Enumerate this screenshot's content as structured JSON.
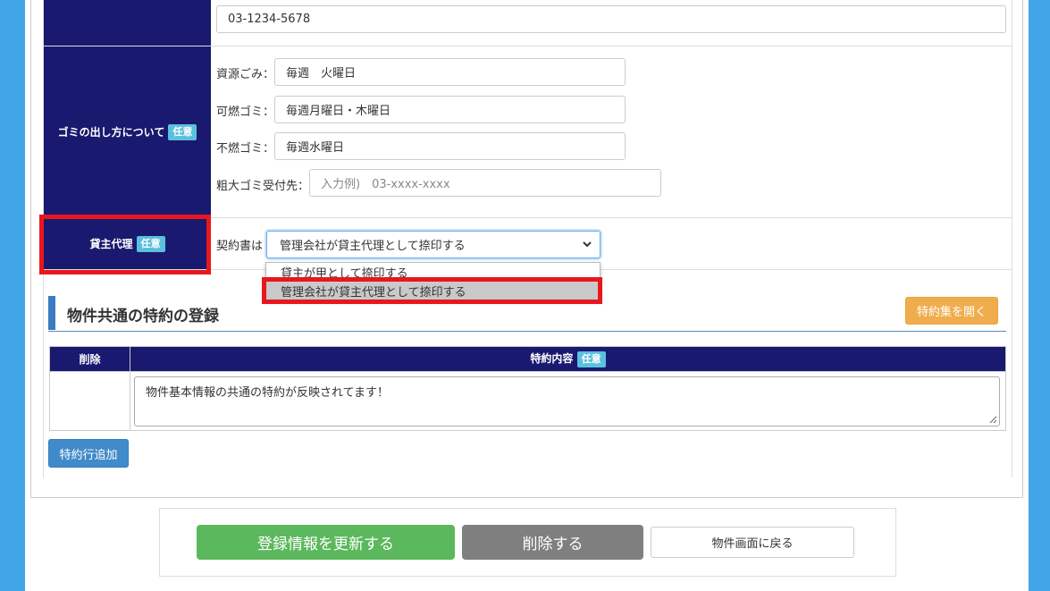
{
  "contact_row": {
    "phone_value": "03-1234-5678"
  },
  "garbage_row": {
    "label": "ゴミの出し方について",
    "badge": "任意",
    "fields": [
      {
        "label": "資源ごみ：",
        "value": "毎週　火曜日"
      },
      {
        "label": "可燃ゴミ：",
        "value": "毎週月曜日・木曜日"
      },
      {
        "label": "不燃ゴミ：",
        "value": "毎週水曜日"
      }
    ],
    "bulky_label": "粗大ゴミ受付先：",
    "bulky_placeholder": "入力例)　03-xxxx-xxxx"
  },
  "landlord_row": {
    "label": "貸主代理",
    "badge": "任意",
    "field_label": "契約書は",
    "selected": "管理会社が貸主代理として捺印する",
    "options": [
      "貸主が甲として捺印する",
      "管理会社が貸主代理として捺印する"
    ]
  },
  "special_terms": {
    "title": "物件共通の特約の登録",
    "open_button": "特約集を開く",
    "col_delete": "削除",
    "col_content": "特約内容",
    "col_badge": "任意",
    "content_value": "物件基本情報の共通の特約が反映されてます！",
    "add_row_button": "特約行追加"
  },
  "footer": {
    "update_button": "登録情報を更新する",
    "delete_button": "削除する",
    "back_button": "物件画面に戻る"
  },
  "colors": {
    "header_navy": "#191970",
    "highlight_red": "#e8171d",
    "background_blue": "#42a5e8"
  }
}
